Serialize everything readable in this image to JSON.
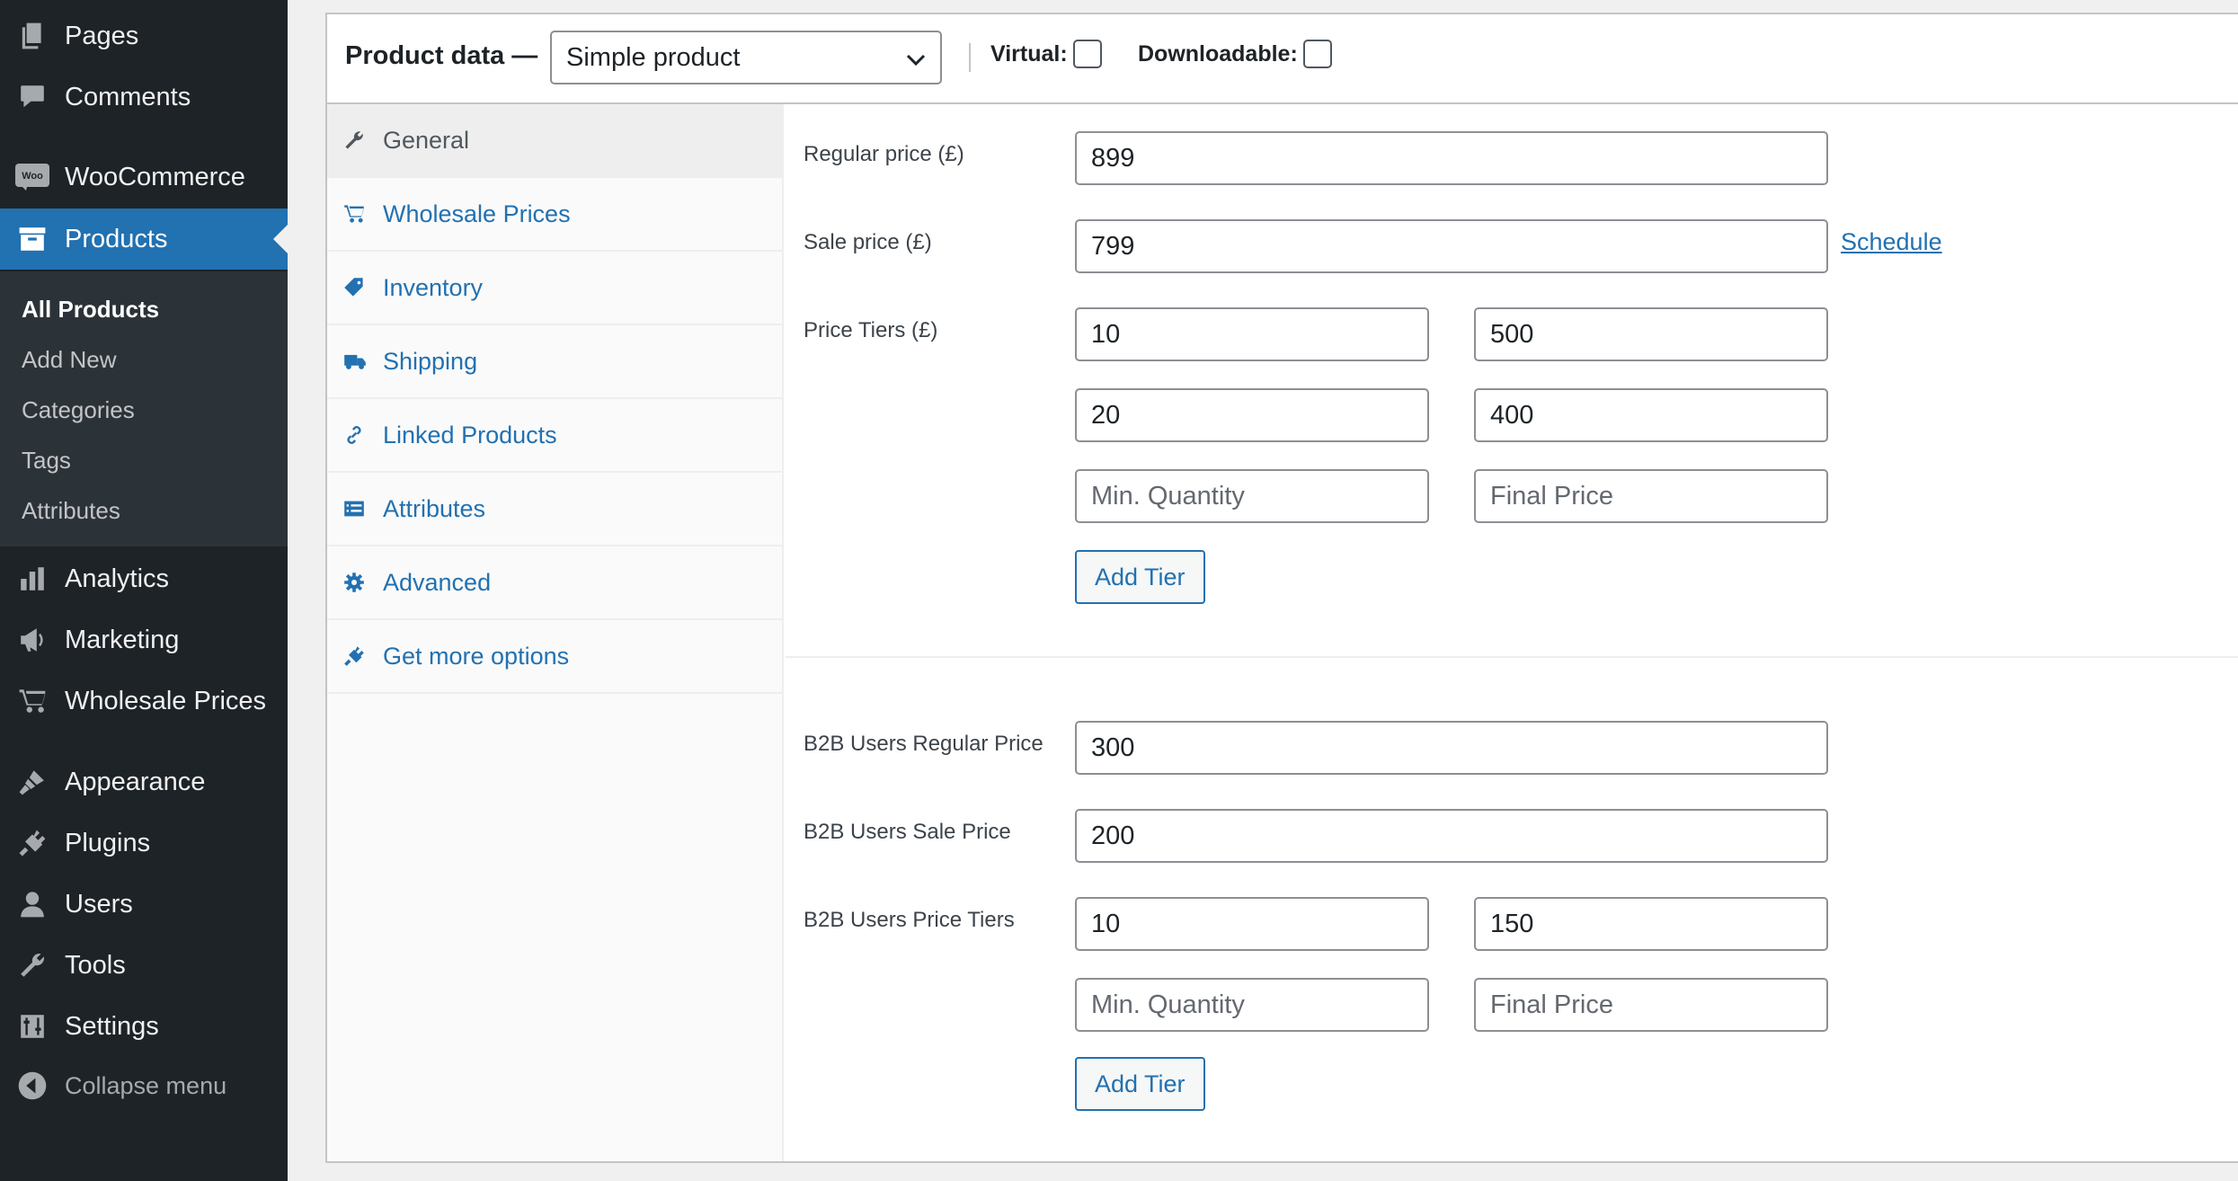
{
  "sidebar": {
    "top_items": [
      {
        "label": "Pages",
        "icon": "pages-icon"
      },
      {
        "label": "Comments",
        "icon": "comments-icon"
      }
    ],
    "woocommerce": {
      "label": "WooCommerce",
      "icon": "woo-icon",
      "icon_text": "Woo"
    },
    "products": {
      "label": "Products",
      "icon": "archive-icon"
    },
    "submenu": [
      "All Products",
      "Add New",
      "Categories",
      "Tags",
      "Attributes"
    ],
    "active_submenu": "All Products",
    "lower_items": [
      {
        "label": "Analytics",
        "icon": "bar-chart-icon"
      },
      {
        "label": "Marketing",
        "icon": "megaphone-icon"
      },
      {
        "label": "Wholesale Prices",
        "icon": "cart-icon"
      },
      {
        "label": "Appearance",
        "icon": "brush-icon"
      },
      {
        "label": "Plugins",
        "icon": "plug-icon"
      },
      {
        "label": "Users",
        "icon": "user-icon"
      },
      {
        "label": "Tools",
        "icon": "wrench-icon"
      },
      {
        "label": "Settings",
        "icon": "sliders-icon"
      }
    ],
    "collapse": "Collapse menu"
  },
  "product_data": {
    "title": "Product data —",
    "type_selected": "Simple product",
    "virtual_label": "Virtual:",
    "downloadable_label": "Downloadable:",
    "virtual_checked": false,
    "downloadable_checked": false
  },
  "tabs": [
    {
      "label": "General",
      "icon": "wrench-icon",
      "active": true
    },
    {
      "label": "Wholesale Prices",
      "icon": "cart-icon"
    },
    {
      "label": "Inventory",
      "icon": "tag-icon"
    },
    {
      "label": "Shipping",
      "icon": "truck-icon"
    },
    {
      "label": "Linked Products",
      "icon": "link-icon"
    },
    {
      "label": "Attributes",
      "icon": "list-icon"
    },
    {
      "label": "Advanced",
      "icon": "gear-icon"
    },
    {
      "label": "Get more options",
      "icon": "plug-icon"
    }
  ],
  "general": {
    "regular_price_label": "Regular price (£)",
    "regular_price": "899",
    "sale_price_label": "Sale price (£)",
    "sale_price": "799",
    "schedule_link": "Schedule",
    "price_tiers_label": "Price Tiers (£)",
    "price_tiers": [
      {
        "qty": "10",
        "price": "500"
      },
      {
        "qty": "20",
        "price": "400"
      }
    ],
    "min_qty_placeholder": "Min. Quantity",
    "final_price_placeholder": "Final Price",
    "add_tier": "Add Tier",
    "b2b_regular_label": "B2B Users Regular Price",
    "b2b_regular": "300",
    "b2b_sale_label": "B2B Users Sale Price",
    "b2b_sale": "200",
    "b2b_tiers_label": "B2B Users Price Tiers",
    "b2b_tiers": [
      {
        "qty": "10",
        "price": "150"
      }
    ]
  },
  "colors": {
    "sidebar_bg": "#1d2327",
    "accent": "#2271b1",
    "page_bg": "#f0f0f1"
  }
}
